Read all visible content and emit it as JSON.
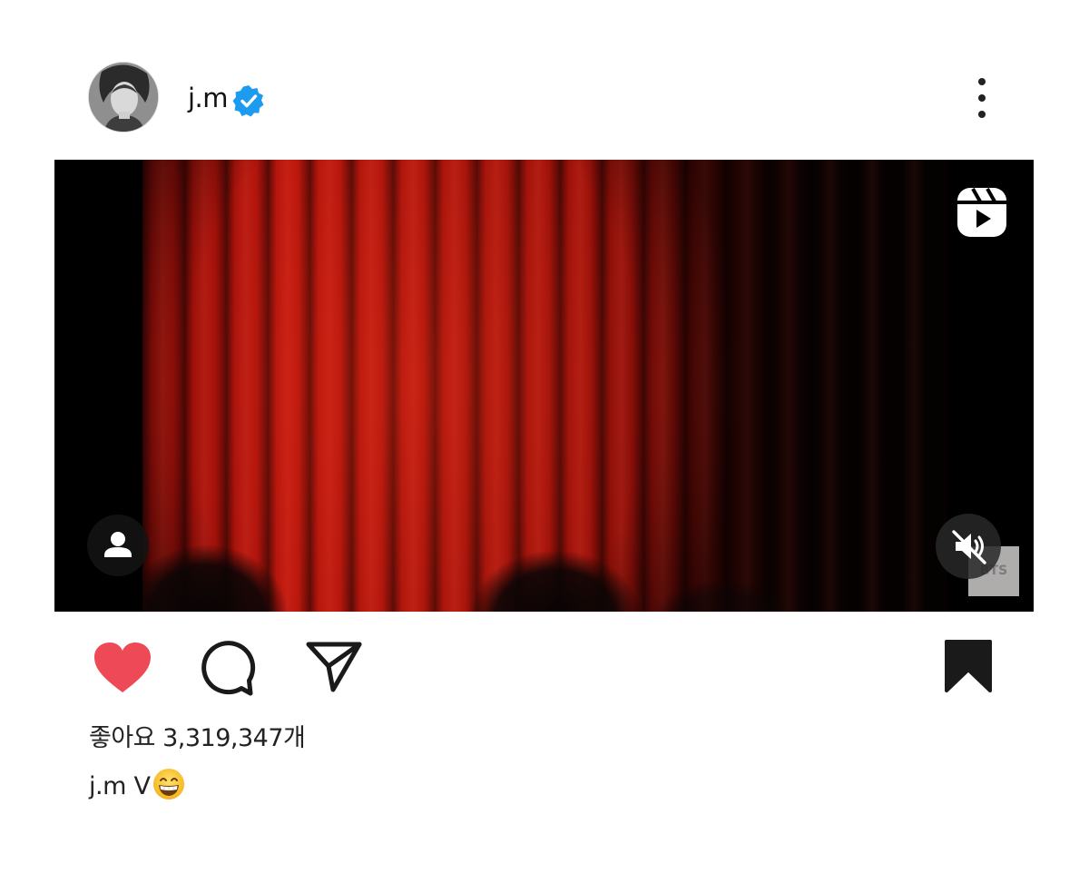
{
  "post": {
    "username": "j.m",
    "verified": true,
    "more_icon": "more-vertical-icon"
  },
  "media": {
    "type": "reel",
    "reels_icon": "reels-icon",
    "user_tag_icon": "user-tag-icon",
    "mute_icon": "speaker-muted-icon",
    "watermark_text": "BTS",
    "dominant_color": "#b3140b"
  },
  "actions": {
    "like_icon": "heart-filled-icon",
    "like_color": "#ed4956",
    "comment_icon": "comment-icon",
    "share_icon": "paper-plane-icon",
    "save_icon": "bookmark-filled-icon"
  },
  "likes_text": "좋아요 3,319,347개",
  "caption": {
    "username": "j.m",
    "text": "V",
    "emoji": "grinning-face-with-smiling-eyes"
  },
  "colors": {
    "verified_blue": "#0095f6",
    "text": "#222222"
  }
}
